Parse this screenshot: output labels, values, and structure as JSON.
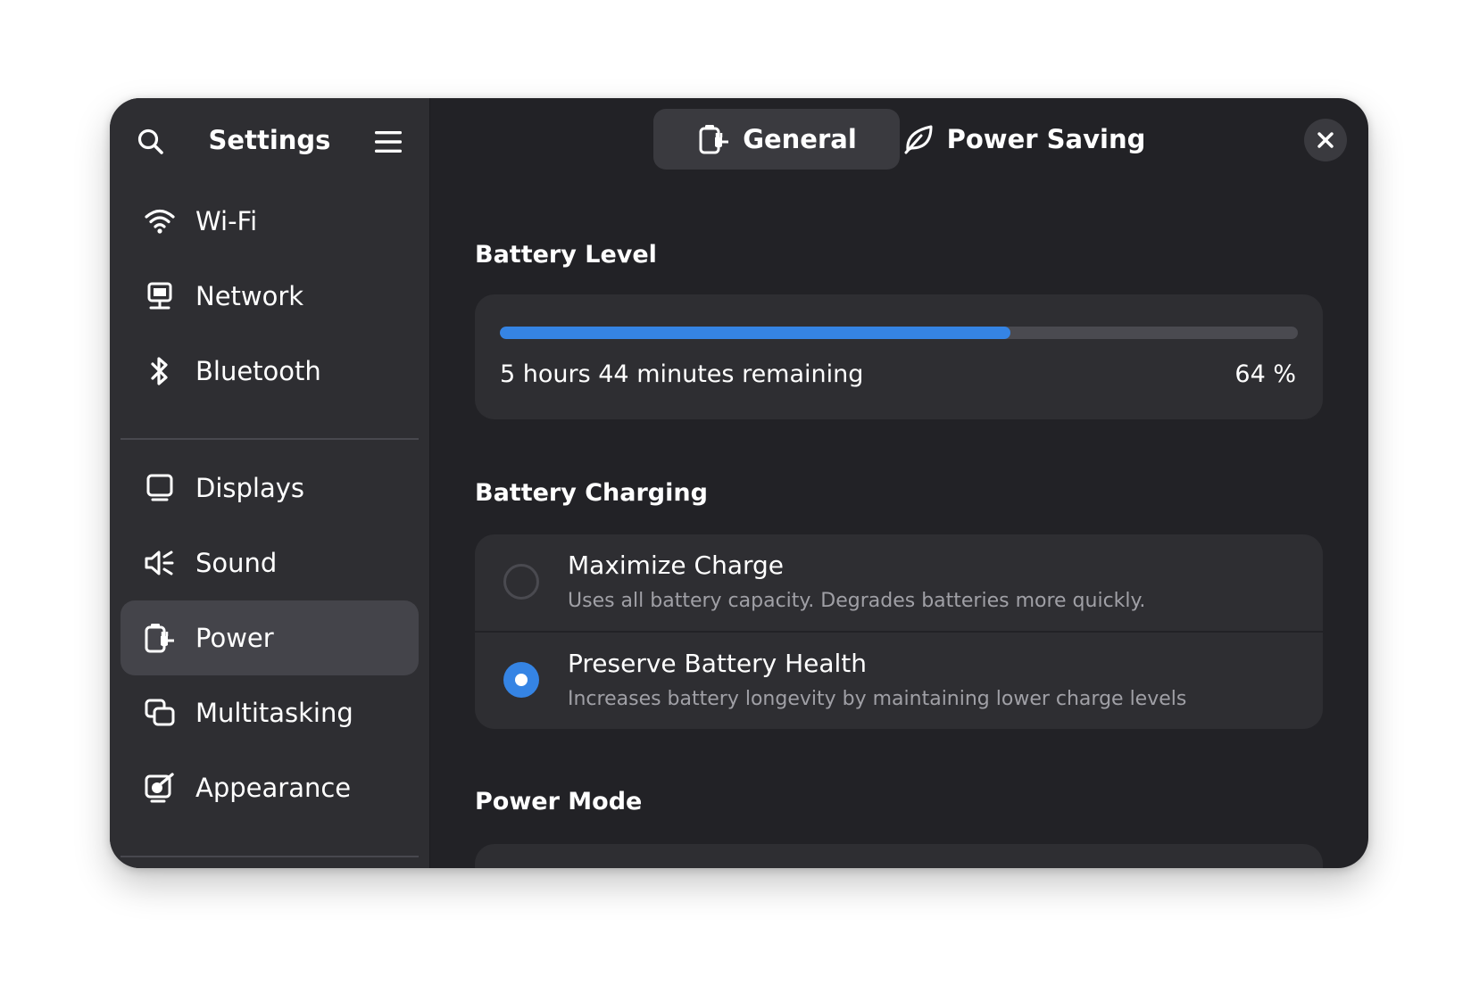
{
  "sidebar": {
    "title": "Settings",
    "items": [
      {
        "label": "Wi-Fi",
        "icon": "wifi-icon"
      },
      {
        "label": "Network",
        "icon": "network-icon"
      },
      {
        "label": "Bluetooth",
        "icon": "bluetooth-icon"
      },
      {
        "label": "Displays",
        "icon": "display-icon"
      },
      {
        "label": "Sound",
        "icon": "sound-icon"
      },
      {
        "label": "Power",
        "icon": "power-icon",
        "active": true
      },
      {
        "label": "Multitasking",
        "icon": "multitasking-icon"
      },
      {
        "label": "Appearance",
        "icon": "appearance-icon"
      }
    ]
  },
  "tabs": [
    {
      "label": "General",
      "icon": "power-plug-icon",
      "active": true
    },
    {
      "label": "Power Saving",
      "icon": "leaf-icon"
    }
  ],
  "battery": {
    "section_title": "Battery Level",
    "remaining": "5 hours 44 minutes remaining",
    "percent_text": "64 %",
    "level": 0.64
  },
  "charging": {
    "section_title": "Battery Charging",
    "options": [
      {
        "title": "Maximize Charge",
        "description": "Uses all battery capacity. Degrades batteries more quickly.",
        "selected": false
      },
      {
        "title": "Preserve Battery Health",
        "description": "Increases battery longevity by maintaining lower charge levels",
        "selected": true
      }
    ]
  },
  "power_mode": {
    "section_title": "Power Mode"
  },
  "colors": {
    "accent": "#3584e4",
    "window_bg": "#222226",
    "sidebar_bg": "#2e2e32"
  }
}
